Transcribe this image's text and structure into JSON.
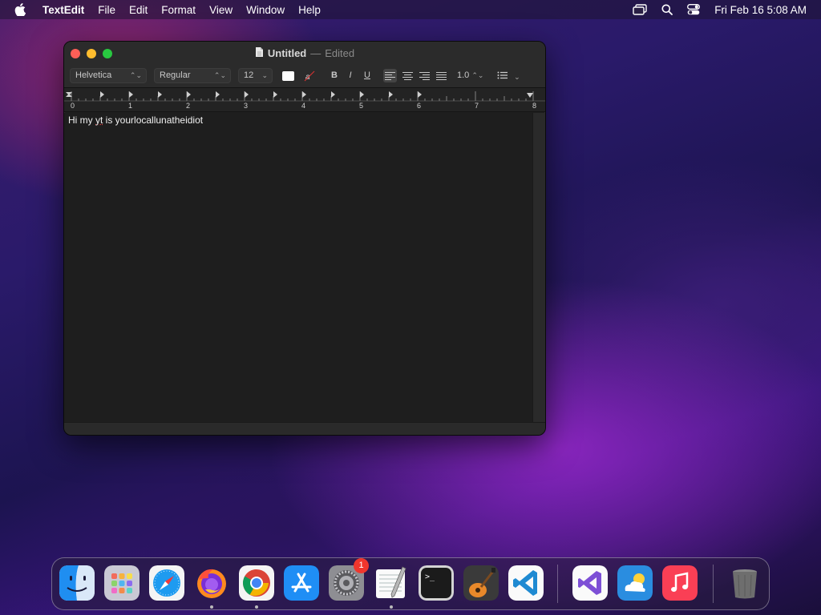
{
  "menubar": {
    "app_name": "TextEdit",
    "items": [
      "File",
      "Edit",
      "Format",
      "View",
      "Window",
      "Help"
    ],
    "clock": "Fri Feb 16  5:08 AM"
  },
  "window": {
    "doc_name": "Untitled",
    "separator": "—",
    "status": "Edited",
    "toolbar": {
      "font_family": "Helvetica",
      "font_style": "Regular",
      "font_size": "12",
      "bold_label": "B",
      "italic_label": "I",
      "underline_label": "U",
      "line_spacing": "1.0"
    },
    "ruler_numbers": [
      "0",
      "1",
      "2",
      "3",
      "4",
      "5",
      "6",
      "7",
      "8"
    ],
    "content": {
      "before": "Hi my ",
      "misspelled": "yt",
      "after": " is yourlocallunatheidiot"
    }
  },
  "dock": {
    "apps": [
      "Finder",
      "Launchpad",
      "Safari",
      "Firefox",
      "Chrome",
      "App Store",
      "System Preferences",
      "TextEdit",
      "Terminal",
      "GarageBand",
      "Visual Studio Code",
      "Visual Studio",
      "Weather",
      "Music",
      "Trash"
    ],
    "settings_badge": "1"
  }
}
